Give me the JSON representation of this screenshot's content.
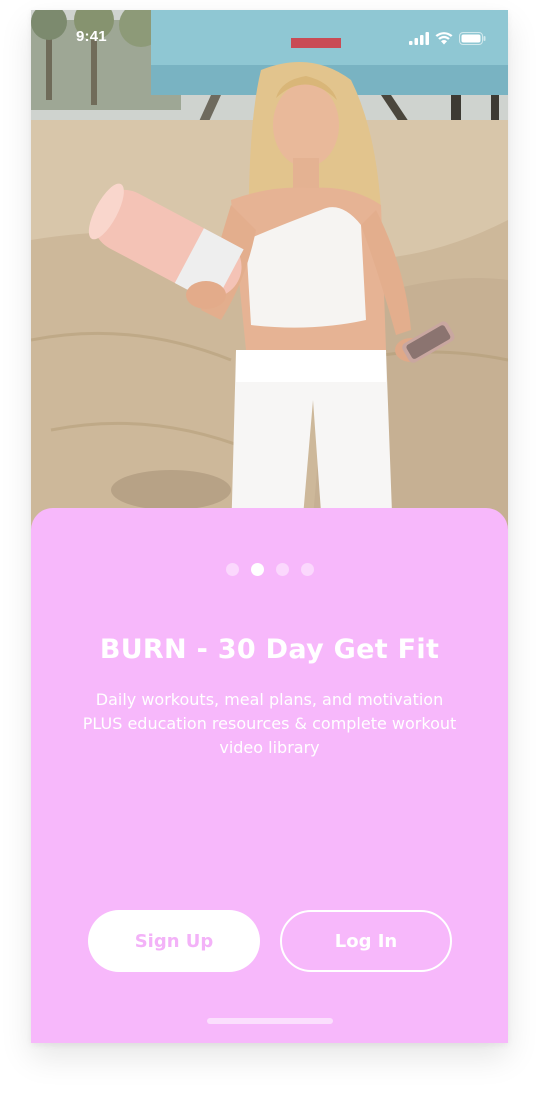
{
  "status_bar": {
    "time": "9:41"
  },
  "onboarding": {
    "page_count": 4,
    "active_page": 2,
    "title": "BURN - 30 Day Get Fit",
    "description": "Daily workouts, meal plans, and motivation PLUS education resources & complete workout video library"
  },
  "actions": {
    "signup_label": "Sign Up",
    "login_label": "Log In"
  },
  "colors": {
    "card_pink": "#f7b8fb",
    "signup_text": "#f3b2f8",
    "white": "#ffffff"
  },
  "icons": [
    "signal-icon",
    "wifi-icon",
    "battery-icon"
  ]
}
